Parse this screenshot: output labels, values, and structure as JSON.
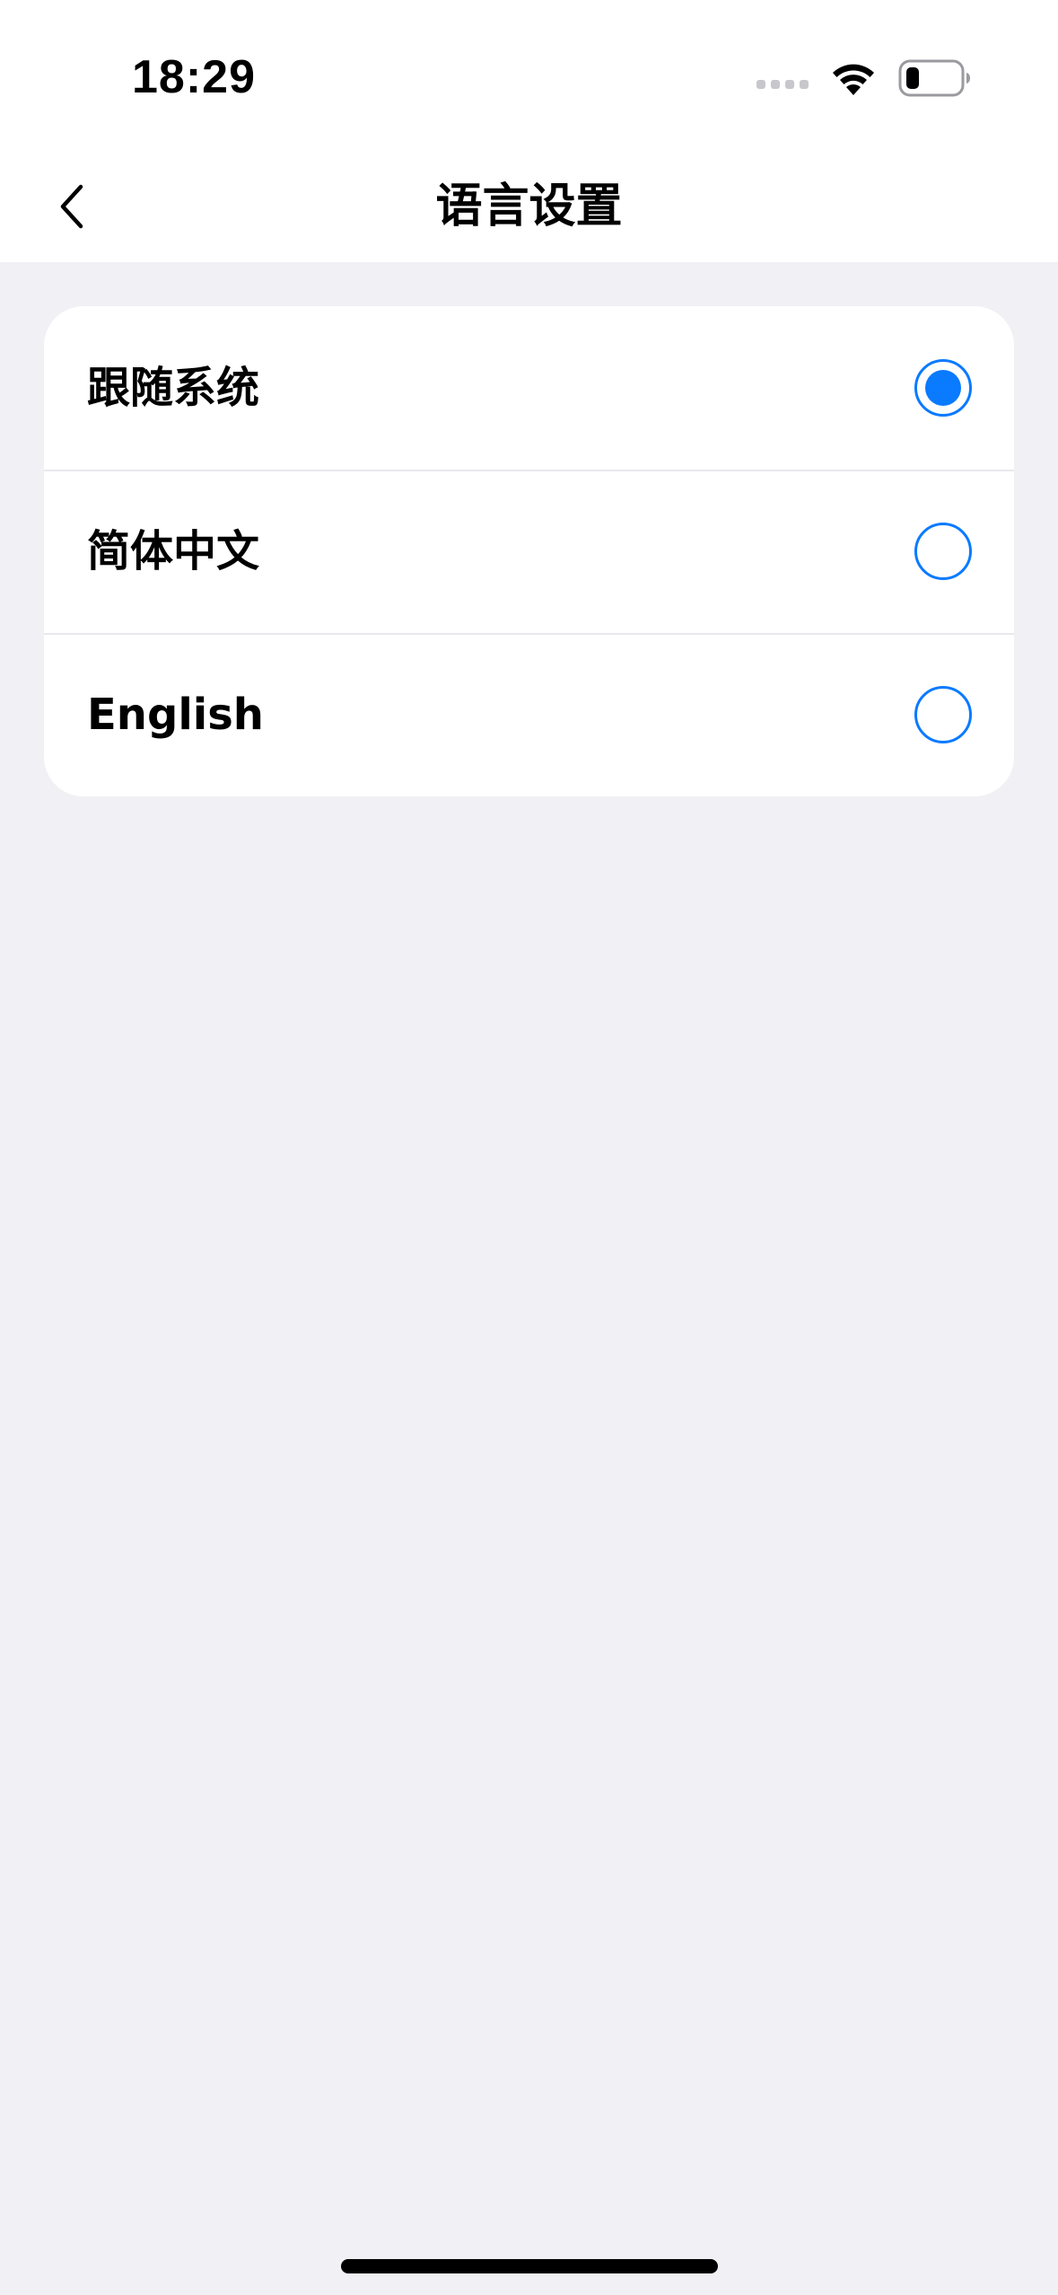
{
  "status_bar": {
    "time": "18:29",
    "icons": [
      "signal-icon",
      "wifi-icon",
      "battery-icon"
    ]
  },
  "nav": {
    "title": "语言设置",
    "back_icon": "chevron-left-icon"
  },
  "languages": [
    {
      "label": "跟随系统",
      "selected": true
    },
    {
      "label": "简体中文",
      "selected": false
    },
    {
      "label": "English",
      "selected": false
    }
  ],
  "colors": {
    "accent": "#0A7AFF",
    "background": "#F0F0F5",
    "card": "#FFFFFF"
  }
}
